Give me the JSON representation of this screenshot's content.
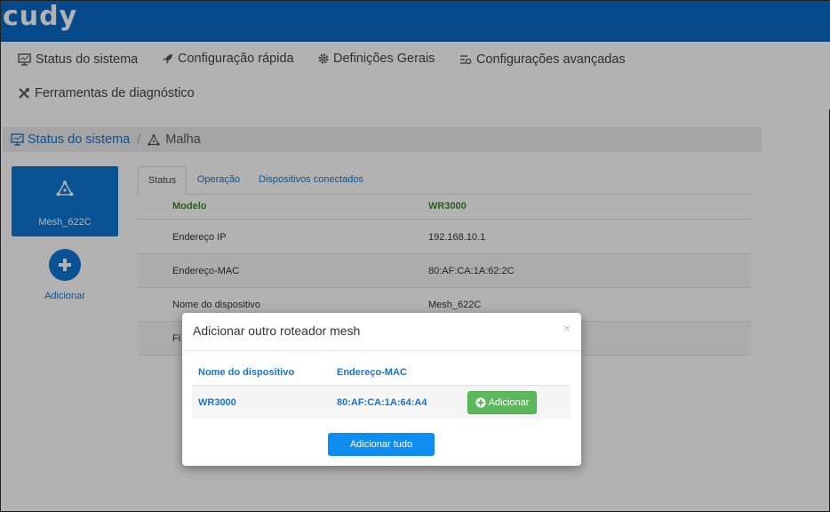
{
  "app": {
    "logo": "cudy"
  },
  "nav": {
    "items": [
      {
        "label": "Status do sistema",
        "icon": "monitor-icon"
      },
      {
        "label": "Configuração rápida",
        "icon": "rocket-icon"
      },
      {
        "label": "Definições Gerais",
        "icon": "gear-icon"
      },
      {
        "label": "Configurações avançadas",
        "icon": "sliders-icon"
      },
      {
        "label": "Ferramentas de diagnóstico",
        "icon": "wrench-icon"
      }
    ]
  },
  "breadcrumb": {
    "parent": "Status do sistema",
    "separator": "/",
    "current": "Malha"
  },
  "mesh": {
    "node_name": "Mesh_622C",
    "add_label": "Adicionar"
  },
  "tabs": [
    {
      "label": "Status",
      "active": true
    },
    {
      "label": "Operação",
      "active": false
    },
    {
      "label": "Dispositivos conectados",
      "active": false
    }
  ],
  "info": {
    "header": {
      "key": "Modelo",
      "value": "WR3000"
    },
    "rows": [
      {
        "key": "Endereço IP",
        "value": "192.168.10.1"
      },
      {
        "key": "Endereço-MAC",
        "value": "80:AF:CA:1A:62:2C"
      },
      {
        "key": "Nome do dispositivo",
        "value": "Mesh_622C"
      },
      {
        "key": "Fi",
        "value": ""
      }
    ]
  },
  "modal": {
    "title": "Adicionar outro roteador mesh",
    "close": "×",
    "columns": {
      "name": "Nome do dispositivo",
      "mac": "Endereço-MAC"
    },
    "devices": [
      {
        "name": "WR3000",
        "mac": "80:AF:CA:1A:64:A4",
        "action": "Adicionar"
      }
    ],
    "add_all": "Adicionar tudo"
  },
  "colors": {
    "brand": "#0869c7",
    "link": "#1a75c9",
    "success": "#5cb85c",
    "primary_button": "#0e8cf0"
  }
}
